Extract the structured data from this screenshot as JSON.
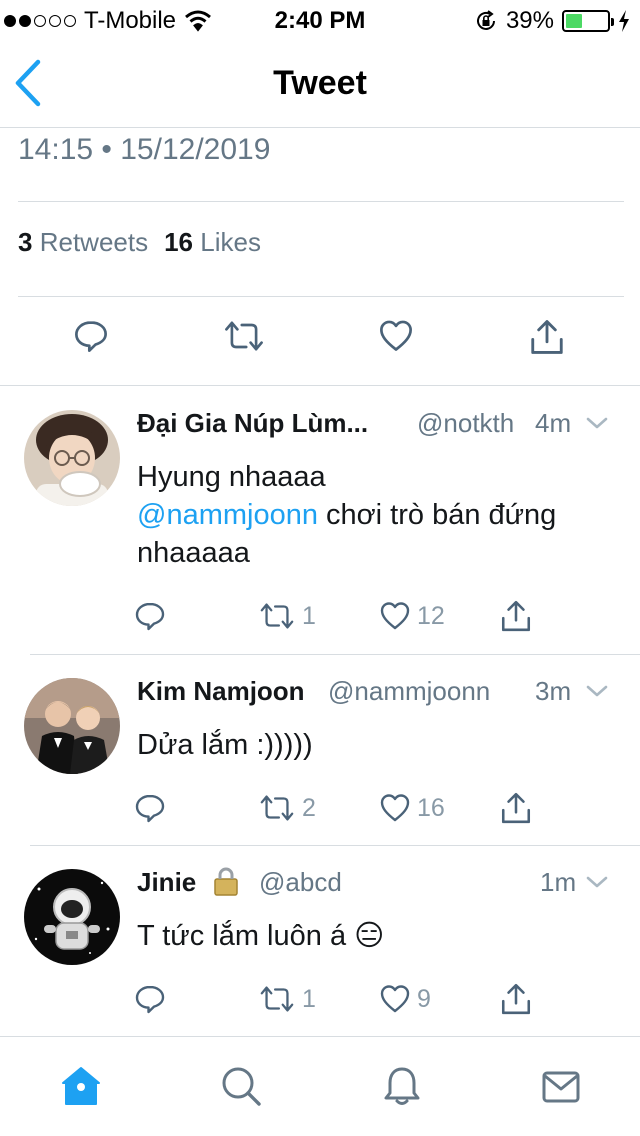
{
  "status_bar": {
    "carrier": "T-Mobile",
    "time": "2:40 PM",
    "battery_percent": "39%",
    "battery_level": 0.39
  },
  "nav": {
    "title": "Tweet"
  },
  "tweet": {
    "timestamp": "14:15 • 15/12/2019",
    "retweets_count": "3",
    "retweets_label": "Retweets",
    "likes_count": "16",
    "likes_label": "Likes"
  },
  "replies": [
    {
      "name": "Đại Gia Núp Lùm...",
      "handle": "@notkth",
      "time": "4m",
      "text_1": "Hyung nhaaaa",
      "mention": "@nammjoonn",
      "text_2": " chơi trò bán đứng nhaaaaa",
      "retweets": "1",
      "likes": "12"
    },
    {
      "name": "Kim Namjoon",
      "handle": "@nammjoonn",
      "time": "3m",
      "text_1": "Dửa lắm :)))))",
      "retweets": "2",
      "likes": "16"
    },
    {
      "name": "Jinie",
      "handle": "@abcd",
      "time": "1m",
      "text_1": "T tức lắm luôn á 😑",
      "retweets": "1",
      "likes": "9"
    }
  ],
  "colors": {
    "accent": "#1da1f2",
    "secondary_text": "#657786",
    "icon": "#4a6278",
    "divider": "#d8dde1"
  }
}
